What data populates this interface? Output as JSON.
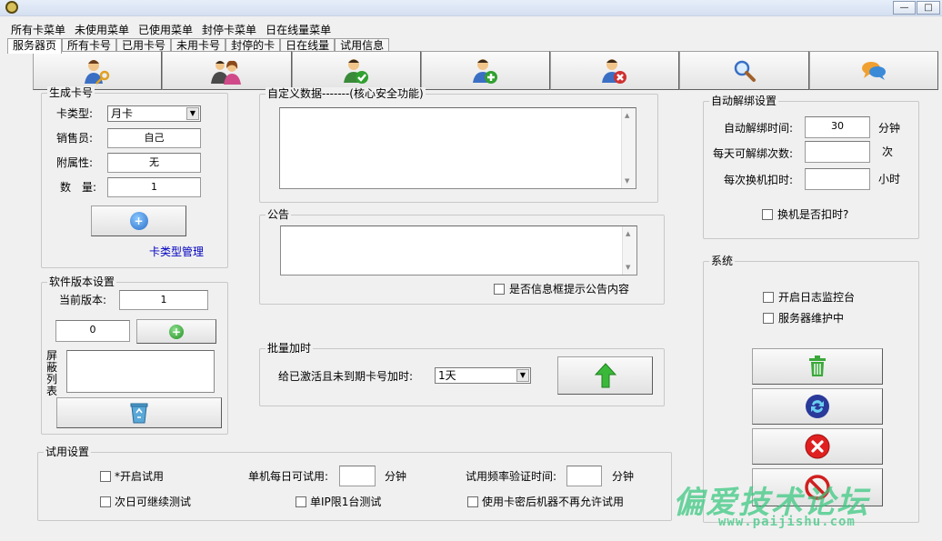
{
  "window": {
    "minimize": "—",
    "maximize": "□",
    "close": "X"
  },
  "menu": [
    "所有卡菜单",
    "未使用菜单",
    "已使用菜单",
    "封停卡菜单",
    "日在线量菜单"
  ],
  "tabs": [
    "服务器页",
    "所有卡号",
    "已用卡号",
    "未用卡号",
    "封停的卡",
    "日在线量",
    "试用信息"
  ],
  "toolbar_icons": [
    "user-key-icon",
    "users-icon",
    "user-check-icon",
    "user-add-icon",
    "user-delete-icon",
    "search-icon",
    "chat-icon"
  ],
  "generate": {
    "title": "生成卡号",
    "card_type_label": "卡类型:",
    "card_type_value": "月卡",
    "seller_label": "销售员:",
    "seller_value": "自己",
    "attr_label": "附属性:",
    "attr_value": "无",
    "qty_label": "数　量:",
    "qty_value": "1",
    "manage_link": "卡类型管理"
  },
  "version": {
    "title": "软件版本设置",
    "current_label": "当前版本:",
    "current_value": "1",
    "input_value": "0",
    "block_label": "屏蔽列表"
  },
  "custom": {
    "title": "自定义数据-------(核心安全功能)"
  },
  "notice": {
    "title": "公告",
    "checkbox_label": "是否信息框提示公告内容"
  },
  "batch": {
    "title": "批量加时",
    "label": "给已激活且未到期卡号加时:",
    "select_value": "1天"
  },
  "trial": {
    "title": "试用设置",
    "enable_label": "*开启试用",
    "next_day_label": "次日可继续测试",
    "per_day_label": "单机每日可试用:",
    "per_day_unit": "分钟",
    "ip_label": "单IP限1台测试",
    "freq_label": "试用频率验证时间:",
    "freq_unit": "分钟",
    "no_trial_label": "使用卡密后机器不再允许试用"
  },
  "unbind": {
    "title": "自动解绑设置",
    "time_label": "自动解绑时间:",
    "time_value": "30",
    "time_unit": "分钟",
    "times_label": "每天可解绑次数:",
    "times_unit": "次",
    "deduct_label": "每次换机扣时:",
    "deduct_unit": "小时",
    "switch_label": "换机是否扣时?"
  },
  "system": {
    "title": "系统",
    "log_label": "开启日志监控台",
    "maint_label": "服务器维护中"
  },
  "watermark": {
    "cn": "偏爱技术论坛",
    "url": "www.paijishu.com"
  }
}
